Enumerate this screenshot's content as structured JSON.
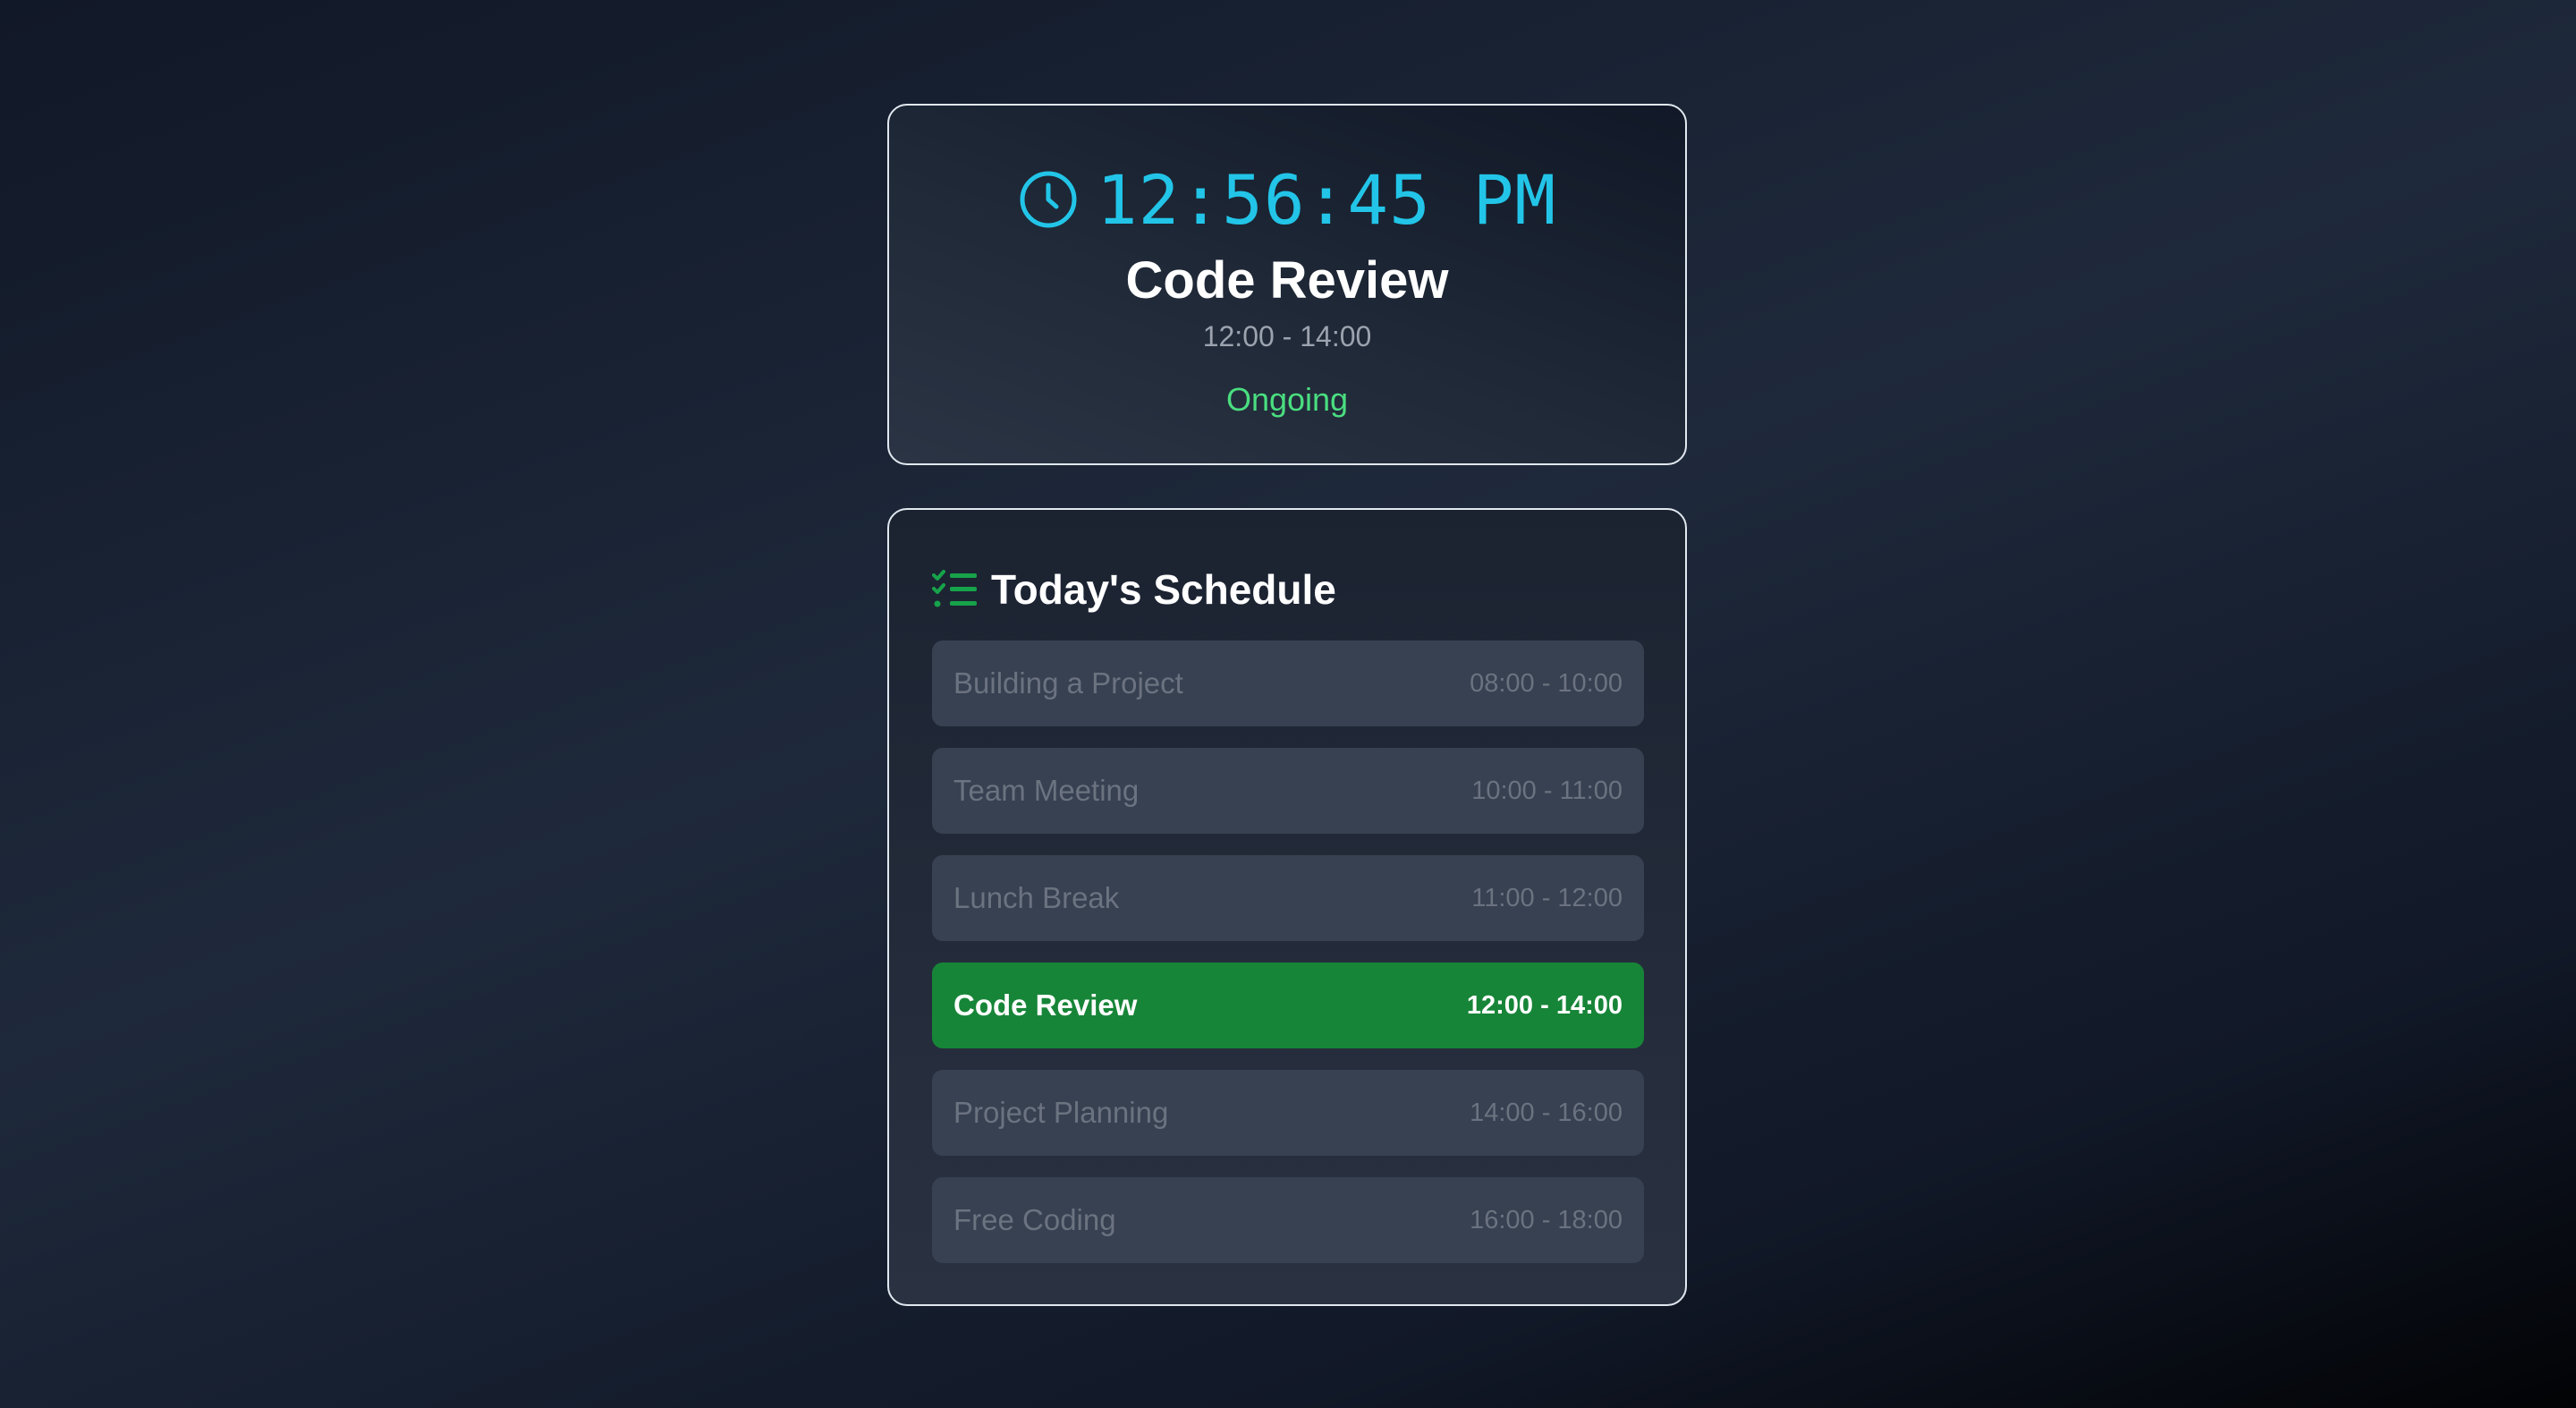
{
  "colors": {
    "accent_clock": "#22c5e8",
    "status_ongoing": "#4ade80",
    "active_item_bg": "#178538",
    "list_icon": "#16a34a"
  },
  "current": {
    "clock_icon": "clock-icon",
    "time": "12:56:45 PM",
    "title": "Code Review",
    "range": "12:00 - 14:00",
    "status": "Ongoing"
  },
  "schedule": {
    "icon": "checklist-icon",
    "title": "Today's Schedule",
    "items": [
      {
        "name": "Building a Project",
        "range": "08:00 - 10:00",
        "active": false
      },
      {
        "name": "Team Meeting",
        "range": "10:00 - 11:00",
        "active": false
      },
      {
        "name": "Lunch Break",
        "range": "11:00 - 12:00",
        "active": false
      },
      {
        "name": "Code Review",
        "range": "12:00 - 14:00",
        "active": true
      },
      {
        "name": "Project Planning",
        "range": "14:00 - 16:00",
        "active": false
      },
      {
        "name": "Free Coding",
        "range": "16:00 - 18:00",
        "active": false
      }
    ]
  }
}
